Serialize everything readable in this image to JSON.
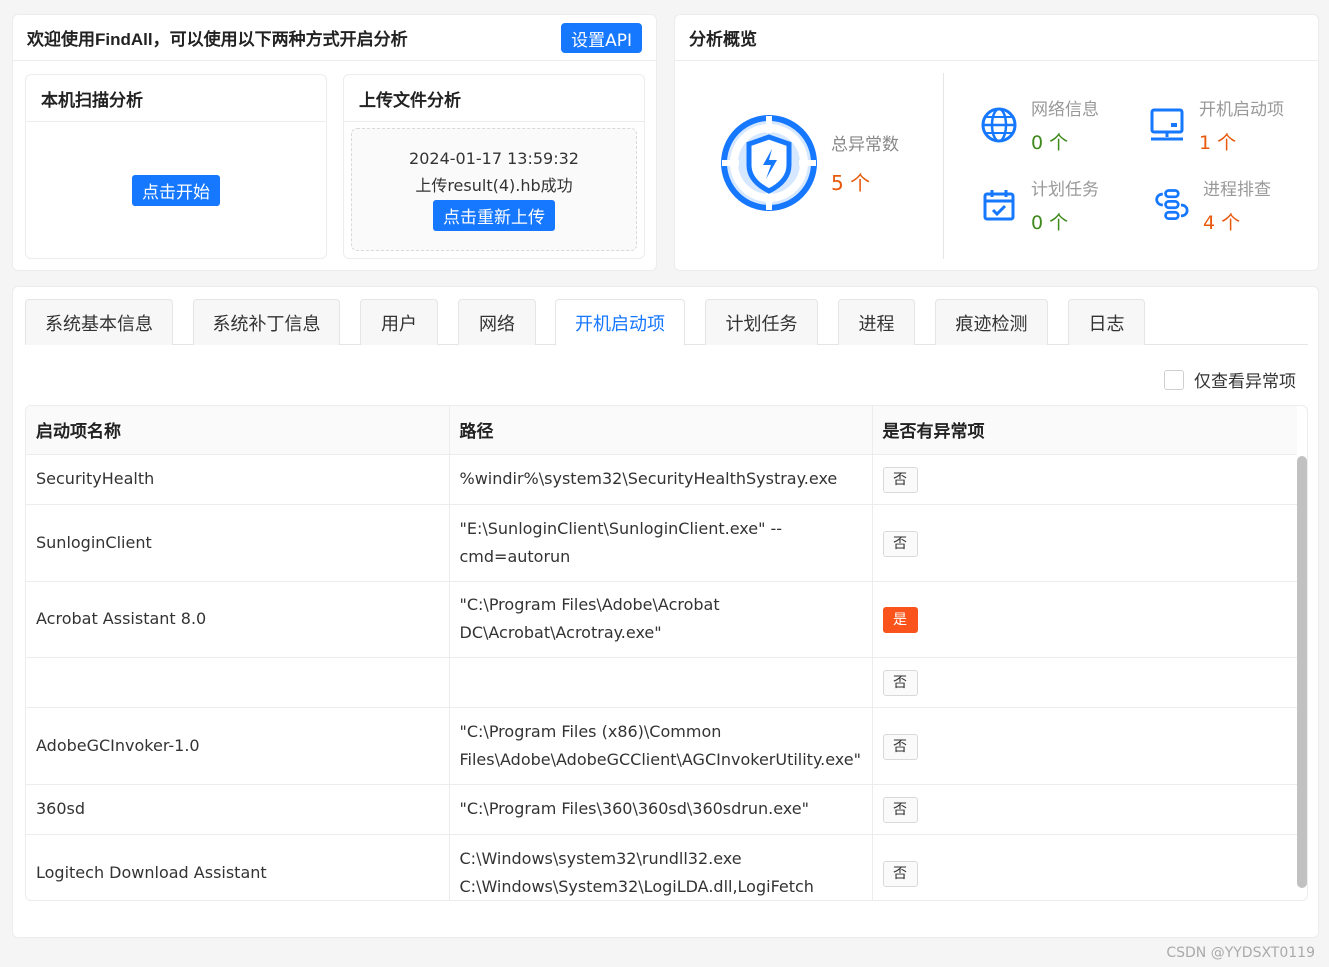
{
  "welcome": {
    "title": "欢迎使用FindAll，可以使用以下两种方式开启分析",
    "api_button": "设置API",
    "local": {
      "title": "本机扫描分析",
      "start_button": "点击开始"
    },
    "upload": {
      "title": "上传文件分析",
      "timestamp": "2024-01-17 13:59:32",
      "status": "上传result(4).hb成功",
      "reupload_button": "点击重新上传"
    }
  },
  "overview": {
    "title": "分析概览",
    "total_label": "总异常数",
    "total_value": "5 个",
    "stats": [
      {
        "label": "网络信息",
        "value": "0 个",
        "icon": "globe-icon",
        "color": "#3f8a1d"
      },
      {
        "label": "开机启动项",
        "value": "1 个",
        "icon": "computer-icon",
        "color": "#e8590c"
      },
      {
        "label": "计划任务",
        "value": "0 个",
        "icon": "calendar-icon",
        "color": "#3f8a1d"
      },
      {
        "label": "进程排查",
        "value": "4 个",
        "icon": "process-icon",
        "color": "#e8590c"
      }
    ],
    "accent_color": "#1677ff"
  },
  "tabs": [
    "系统基本信息",
    "系统补丁信息",
    "用户",
    "网络",
    "开机启动项",
    "计划任务",
    "进程",
    "痕迹检测",
    "日志"
  ],
  "active_tab": "开机启动项",
  "filter": {
    "label": "仅查看异常项",
    "checked": false
  },
  "table": {
    "columns": [
      "启动项名称",
      "路径",
      "是否有异常项"
    ],
    "rows": [
      {
        "name": "SecurityHealth",
        "path": "%windir%\\system32\\SecurityHealthSystray.exe",
        "abnormal": "否"
      },
      {
        "name": "SunloginClient",
        "path": "\"E:\\SunloginClient\\SunloginClient.exe\" --cmd=autorun",
        "abnormal": "否"
      },
      {
        "name": "Acrobat Assistant 8.0",
        "path": "\"C:\\Program Files\\Adobe\\Acrobat DC\\Acrobat\\Acrotray.exe\"",
        "abnormal": "是"
      },
      {
        "name": "",
        "path": "",
        "abnormal": "否"
      },
      {
        "name": "AdobeGCInvoker-1.0",
        "path": "\"C:\\Program Files (x86)\\Common Files\\Adobe\\AdobeGCClient\\AGCInvokerUtility.exe\"",
        "abnormal": "否"
      },
      {
        "name": "360sd",
        "path": "\"C:\\Program Files\\360\\360sd\\360sdrun.exe\"",
        "abnormal": "否"
      },
      {
        "name": "Logitech Download Assistant",
        "path": "C:\\Windows\\system32\\rundll32.exe C:\\Windows\\System32\\LogiLDA.dll,LogiFetch",
        "abnormal": "否"
      }
    ]
  },
  "watermark": "CSDN @YYDSXT0119"
}
